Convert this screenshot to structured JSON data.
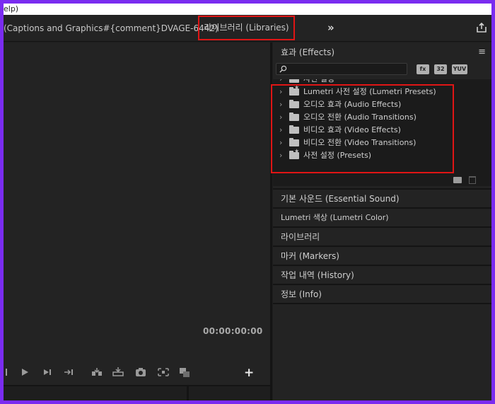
{
  "menubar": {
    "text": "elp)"
  },
  "tabs": {
    "captions": "(Captions and Graphics#{comment}DVAGE-6442)",
    "libraries": "라이브러리 (Libraries)",
    "more": "»"
  },
  "monitor": {
    "timecode": "00:00:00:00",
    "transport_icons": [
      "mark-in-icon",
      "play-icon",
      "step-forward-icon",
      "go-to-out-icon",
      "insert-icon",
      "overwrite-icon",
      "export-frame-icon",
      "safe-margins-icon",
      "compare-view-icon"
    ],
    "add_label": "+"
  },
  "effects": {
    "title": "효과 (Effects)",
    "menu": "≡",
    "search": {
      "value": "",
      "placeholder": ""
    },
    "toolbar_icons": [
      "accelerated-effects-icon",
      "32-bit-effects-icon",
      "yuv-effects-icon"
    ],
    "toolbar_labels": [
      "fx",
      "32",
      "YUV"
    ],
    "items": [
      {
        "label": "사전 설정",
        "icon": "star-folder-icon"
      },
      {
        "label": "Lumetri 사전 설정 (Lumetri Presets)",
        "icon": "star-folder-icon"
      },
      {
        "label": "오디오 효과 (Audio Effects)",
        "icon": "folder-icon"
      },
      {
        "label": "오디오 전환 (Audio Transitions)",
        "icon": "folder-icon"
      },
      {
        "label": "비디오 효과 (Video Effects)",
        "icon": "folder-icon"
      },
      {
        "label": "비디오 전환 (Video Transitions)",
        "icon": "folder-icon"
      },
      {
        "label": "사전 설정 (Presets)",
        "icon": "star-folder-icon"
      }
    ]
  },
  "panels": [
    "기본 사운드 (Essential Sound)",
    "Lumetri 색상 (Lumetri Color)",
    "라이브러리",
    "마커 (Markers)",
    "작업 내역 (History)",
    "정보 (Info)"
  ],
  "colors": {
    "border_frame": "#7a2cf0",
    "highlight": "#e01515",
    "panel_bg": "#232323"
  }
}
